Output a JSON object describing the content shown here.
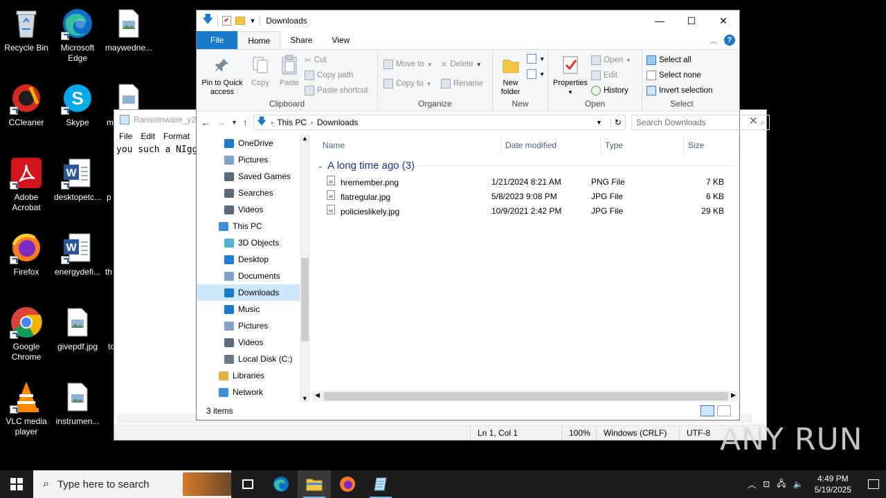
{
  "desktop": {
    "icons": [
      {
        "label": "Recycle Bin",
        "icon": "recycle-bin-icon"
      },
      {
        "label": "Microsoft Edge",
        "icon": "edge-icon"
      },
      {
        "label": "maywedne...",
        "icon": "image-file-icon"
      },
      {
        "label": "CCleaner",
        "icon": "ccleaner-icon"
      },
      {
        "label": "Skype",
        "icon": "skype-icon"
      },
      {
        "label": "m",
        "icon": "image-file-icon"
      },
      {
        "label": "Adobe Acrobat",
        "icon": "acrobat-icon"
      },
      {
        "label": "desktopetc...",
        "icon": "word-doc-icon"
      },
      {
        "label": "p",
        "icon": "file-icon"
      },
      {
        "label": "Firefox",
        "icon": "firefox-icon"
      },
      {
        "label": "energydefi...",
        "icon": "word-doc-icon"
      },
      {
        "label": "th",
        "icon": "file-icon"
      },
      {
        "label": "Google Chrome",
        "icon": "chrome-icon"
      },
      {
        "label": "givepdf.jpg",
        "icon": "image-file-icon"
      },
      {
        "label": "to",
        "icon": "file-icon"
      },
      {
        "label": "VLC media player",
        "icon": "vlc-icon"
      },
      {
        "label": "instrumen...",
        "icon": "image-file-icon"
      }
    ]
  },
  "notepad": {
    "title": "Ransomware_y2T",
    "menu": [
      "File",
      "Edit",
      "Format"
    ],
    "text": "you such a NIgg",
    "status": {
      "position": "Ln 1, Col 1",
      "zoom": "100%",
      "eol": "Windows (CRLF)",
      "encoding": "UTF-8"
    }
  },
  "explorer": {
    "title": "Downloads",
    "tabs": {
      "file": "File",
      "home": "Home",
      "share": "Share",
      "view": "View"
    },
    "ribbon": {
      "clipboard": {
        "label": "Clipboard",
        "pin": "Pin to Quick access",
        "copy": "Copy",
        "paste": "Paste",
        "cut": "Cut",
        "copy_path": "Copy path",
        "paste_shortcut": "Paste shortcut"
      },
      "organize": {
        "label": "Organize",
        "move_to": "Move to",
        "copy_to": "Copy to",
        "delete": "Delete",
        "rename": "Rename"
      },
      "new": {
        "label": "New",
        "new_folder": "New folder"
      },
      "open": {
        "label": "Open",
        "properties": "Properties",
        "open": "Open",
        "edit": "Edit",
        "history": "History"
      },
      "select": {
        "label": "Select",
        "select_all": "Select all",
        "select_none": "Select none",
        "invert": "Invert selection"
      }
    },
    "address": {
      "crumbs": [
        "This PC",
        "Downloads"
      ],
      "search_placeholder": "Search Downloads"
    },
    "nav_items": [
      {
        "label": "OneDrive",
        "icon": "cloud-icon",
        "indent": 1
      },
      {
        "label": "Pictures",
        "icon": "pictures-icon",
        "indent": 1
      },
      {
        "label": "Saved Games",
        "icon": "saved-games-icon",
        "indent": 1
      },
      {
        "label": "Searches",
        "icon": "search-folder-icon",
        "indent": 1
      },
      {
        "label": "Videos",
        "icon": "videos-icon",
        "indent": 1
      },
      {
        "label": "This PC",
        "icon": "computer-icon",
        "indent": 0
      },
      {
        "label": "3D Objects",
        "icon": "3d-objects-icon",
        "indent": 1
      },
      {
        "label": "Desktop",
        "icon": "desktop-folder-icon",
        "indent": 1
      },
      {
        "label": "Documents",
        "icon": "documents-icon",
        "indent": 1
      },
      {
        "label": "Downloads",
        "icon": "downloads-icon",
        "indent": 1,
        "selected": true
      },
      {
        "label": "Music",
        "icon": "music-icon",
        "indent": 1
      },
      {
        "label": "Pictures",
        "icon": "pictures-icon",
        "indent": 1
      },
      {
        "label": "Videos",
        "icon": "videos-icon",
        "indent": 1
      },
      {
        "label": "Local Disk (C:)",
        "icon": "drive-icon",
        "indent": 1
      },
      {
        "label": "Libraries",
        "icon": "libraries-icon",
        "indent": 0
      },
      {
        "label": "Network",
        "icon": "network-icon",
        "indent": 0
      }
    ],
    "columns": [
      "Name",
      "Date modified",
      "Type",
      "Size"
    ],
    "group": "A long time ago (3)",
    "files": [
      {
        "name": "hremember.png",
        "date": "1/21/2024 8:21 AM",
        "type": "PNG File",
        "size": "7 KB"
      },
      {
        "name": "flatregular.jpg",
        "date": "5/8/2023 9:08 PM",
        "type": "JPG File",
        "size": "6 KB"
      },
      {
        "name": "policieslikely.jpg",
        "date": "10/9/2021 2:42 PM",
        "type": "JPG File",
        "size": "29 KB"
      }
    ],
    "status": "3 items"
  },
  "taskbar": {
    "search_placeholder": "Type here to search",
    "time": "4:49 PM",
    "date": "5/19/2025"
  },
  "watermark": "ANY RUN"
}
